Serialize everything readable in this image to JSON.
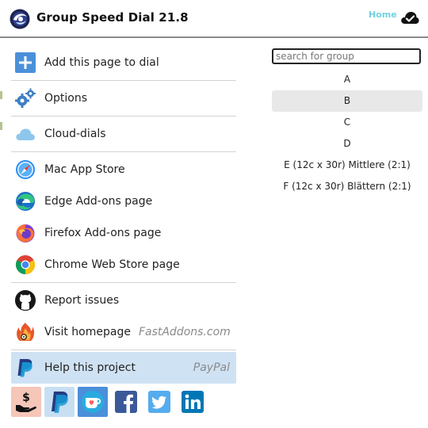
{
  "header": {
    "title": "Group Speed Dial 21.8",
    "home_link": "Home"
  },
  "menu": {
    "add_to_dial": "Add this page to dial",
    "options": "Options",
    "cloud_dials": "Cloud-dials",
    "mac_app_store": "Mac App Store",
    "edge_addons": "Edge Add-ons page",
    "firefox_addons": "Firefox Add-ons page",
    "chrome_store": "Chrome Web Store page",
    "report_issues": "Report issues",
    "visit_homepage": "Visit homepage",
    "homepage_site": "FastAddons.com",
    "help_project": "Help this project",
    "help_via": "PayPal"
  },
  "search": {
    "placeholder": "search for group",
    "value": ""
  },
  "groups": [
    "A",
    "B",
    "C",
    "D",
    "E (12c x 30r) Mittlere (2:1)",
    "F (12c x 30r) Blättern (2:1)"
  ],
  "selected_group_index": 1,
  "share_icons": [
    "donate-hand-icon",
    "paypal-icon",
    "kofi-icon",
    "facebook-icon",
    "twitter-icon",
    "linkedin-icon"
  ],
  "colors": {
    "home_link": "#6fd3df",
    "highlight": "#cfe2f4",
    "selected_group": "#e8e8e8",
    "add_button": "#4a90d9"
  }
}
